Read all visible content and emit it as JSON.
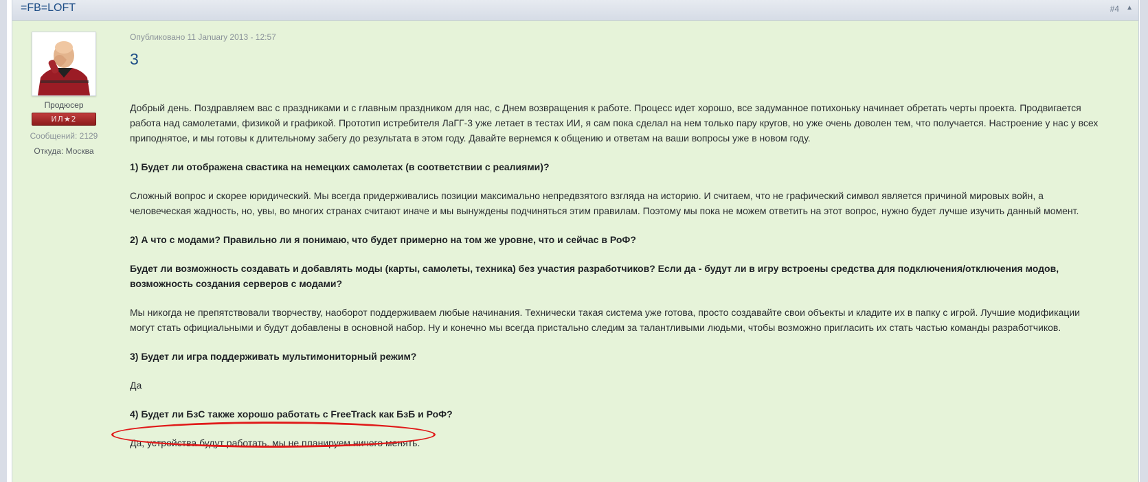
{
  "post": {
    "author": "=FB=LOFT",
    "number": "#4",
    "top_arrow": "▲",
    "member_title": "Продюсер",
    "rank_badge": "ИЛ★2",
    "posts_label": "Сообщений:",
    "posts_value": "2129",
    "from_label": "Откуда:",
    "from_value": "Москва",
    "published": "Опубликовано 11 January 2013 - 12:57",
    "title": "3",
    "paragraphs": [
      {
        "type": "text",
        "text": "Добрый день. Поздравляем вас с праздниками и с главным праздником для нас, с Днем возвращения к работе. Процесс идет хорошо, все задуманное потихоньку начинает обретать черты проекта. Продвигается работа над самолетами, физикой и графикой. Прототип истребителя ЛаГГ-3 уже летает в тестах ИИ, я сам пока сделал на нем только пару кругов, но уже очень доволен тем, что получается. Настроение у нас у всех приподнятое, и мы готовы к длительному забегу до результата в этом году. Давайте вернемся к общению и ответам на ваши вопросы уже в новом году."
      },
      {
        "type": "question",
        "text": "1) Будет ли отображена свастика на немецких самолетах (в соответствии с реалиями)?"
      },
      {
        "type": "text",
        "text": "Сложный вопрос и скорее юридический. Мы всегда придерживались позиции максимально непредвзятого взгляда на историю. И считаем, что не графический символ является причиной мировых войн, а человеческая жадность, но, увы, во многих странах считают иначе и мы вынуждены подчиняться этим правилам. Поэтому мы пока не можем ответить на этот вопрос, нужно будет лучше изучить данный момент."
      },
      {
        "type": "question",
        "text": "2) А что с модами? Правильно ли я понимаю, что будет примерно на том же уровне, что и сейчас в РоФ?"
      },
      {
        "type": "question",
        "text": "Будет ли возможность создавать и добавлять моды (карты, самолеты, техника) без участия разработчиков? Если да - будут ли в игру встроены средства для подключения/отключения модов, возможность создания серверов с модами?"
      },
      {
        "type": "text",
        "text": "Мы никогда не препятствовали творчеству, наоборот поддерживаем любые начинания. Технически такая система уже готова, просто создавайте свои объекты и кладите их в папку с игрой. Лучшие модификации могут стать официальными и будут добавлены в основной набор. Ну и конечно мы всегда пристально следим за талантливыми людьми, чтобы возможно пригласить их стать частью команды разработчиков."
      },
      {
        "type": "question",
        "text": "3) Будет ли игра поддерживать мультимониторный режим?"
      },
      {
        "type": "text",
        "text": "Да"
      },
      {
        "type": "question",
        "text": "4) Будет ли БзС также хорошо работать с FreeTrack как БзБ и РоФ?"
      },
      {
        "type": "text",
        "text": "Да, устройства будут работать, мы не планируем ничего менять."
      }
    ]
  },
  "colors": {
    "post_background": "#e6f3d9",
    "header_background": "#dde2ea",
    "link_blue": "#1d4d86",
    "rank_badge_red": "#a82a2a",
    "annotation_red": "#e01a1a"
  }
}
